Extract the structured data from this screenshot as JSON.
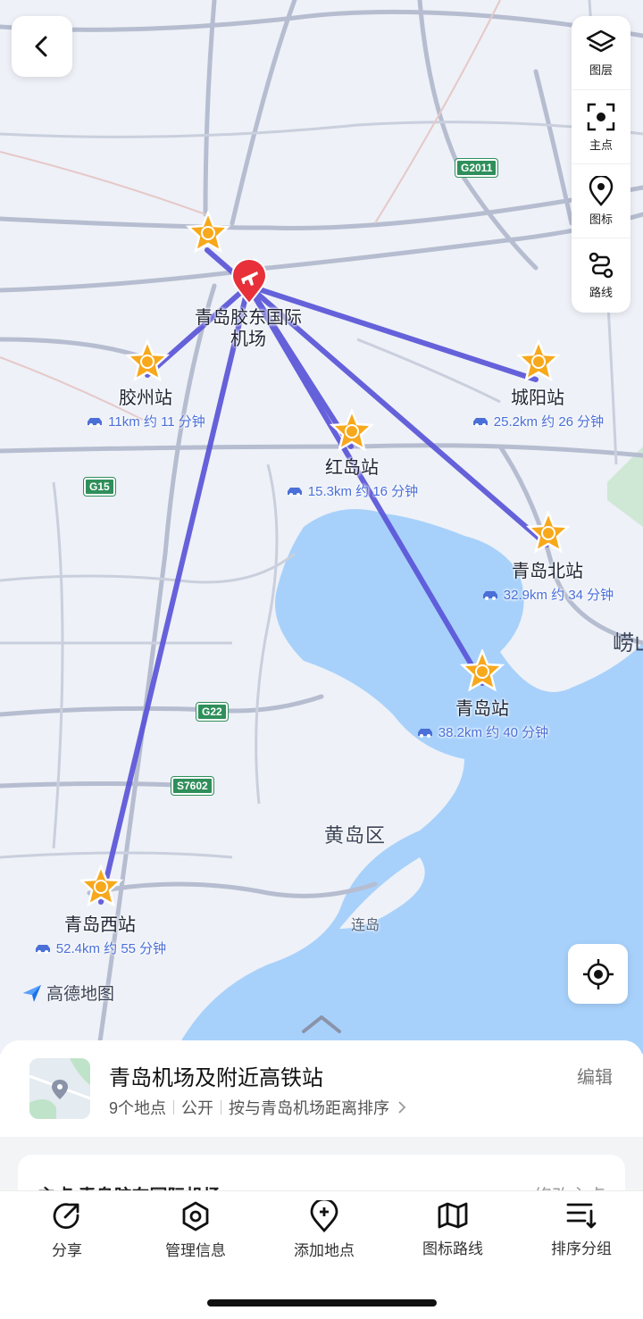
{
  "top_controls": {
    "back": "back",
    "tools": [
      {
        "label": "图层",
        "icon": "layers-icon"
      },
      {
        "label": "主点",
        "icon": "focus-point-icon"
      },
      {
        "label": "图标",
        "icon": "map-pin-icon"
      },
      {
        "label": "路线",
        "icon": "route-icon"
      }
    ]
  },
  "map": {
    "airport": {
      "name_line1": "青岛胶东国际",
      "name_line2": "机场"
    },
    "stations": [
      {
        "name": "胶州站",
        "distance": "11km 约 11 分钟"
      },
      {
        "name": "城阳站",
        "distance": "25.2km 约 26 分钟"
      },
      {
        "name": "红岛站",
        "distance": "15.3km 约 16 分钟"
      },
      {
        "name": "青岛北站",
        "distance": "32.9km 约 34 分钟"
      },
      {
        "name": "青岛站",
        "distance": "38.2km 约 40 分钟"
      },
      {
        "name": "青岛西站",
        "distance": "52.4km 约 55 分钟"
      }
    ],
    "highways": [
      "G2011",
      "G15",
      "G22",
      "S7602"
    ],
    "labels": {
      "district": "黄岛区",
      "island": "连岛",
      "edge": "崂山"
    },
    "logo": "高德地图",
    "colors": {
      "route": "#5a55d8",
      "water": "#a7d1fb",
      "marker": "#f7a81b",
      "airport": "#e8303a"
    }
  },
  "sheet": {
    "title": "青岛机场及附近高铁站",
    "edit": "编辑",
    "count": "9个地点",
    "visibility": "公开",
    "sort": "按与青岛机场距离排序",
    "peek_left": "主点  青岛胶东国际机场",
    "peek_right": "修改主点"
  },
  "tabs": [
    {
      "label": "分享",
      "icon": "share-icon"
    },
    {
      "label": "管理信息",
      "icon": "manage-icon"
    },
    {
      "label": "添加地点",
      "icon": "add-place-icon"
    },
    {
      "label": "图标路线",
      "icon": "map-route-icon"
    },
    {
      "label": "排序分组",
      "icon": "sort-group-icon"
    }
  ]
}
